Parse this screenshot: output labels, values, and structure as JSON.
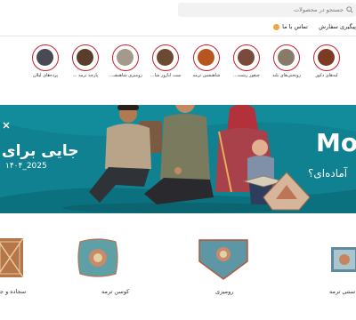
{
  "search": {
    "placeholder": "جستجو در محصولات"
  },
  "top_links": {
    "track_order": "پیگیری سفارش",
    "contact_us": "تماس با ما"
  },
  "categories": [
    {
      "label": "لبه‌های دکور",
      "color": "#7b3b22"
    },
    {
      "label": "روتختی‌های بلند",
      "color": "#8a7a6a"
    },
    {
      "label": "چیغور رشت...",
      "color": "#7a4a3a"
    },
    {
      "label": "شاهنشین ترمه",
      "color": "#b8541f"
    },
    {
      "label": "ست آباژور شا...",
      "color": "#6a4b32"
    },
    {
      "label": "رومیزی شاهنشـ...",
      "color": "#a59a8a"
    },
    {
      "label": "پارچه ترمه ...",
      "color": "#5a3d2b"
    },
    {
      "label": "پرده‌های لیلان",
      "color": "#4a4a52"
    }
  ],
  "banner": {
    "left_title": "جایی برای",
    "left_date": "۱۴۰۴_2025",
    "brand": "Mo",
    "right_text": "آماده‌ای؟",
    "bg_color": "#0e7c8a"
  },
  "products": [
    {
      "name": "سجاده و جا"
    },
    {
      "name": "کوسن ترمه"
    },
    {
      "name": "رومیزی"
    },
    {
      "name": "سنتی ترمه"
    }
  ]
}
